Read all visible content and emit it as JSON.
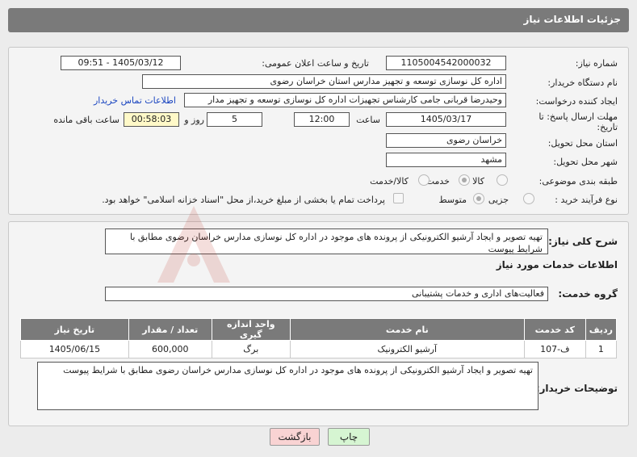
{
  "header": {
    "title": "جزئیات اطلاعات نیاز"
  },
  "form": {
    "need_number_label": "شماره نیاز:",
    "need_number": "1105004542000032",
    "announce_label": "تاریخ و ساعت اعلان عمومی:",
    "announce_value": "1405/03/12 - 09:51",
    "buyer_org_label": "نام دستگاه خریدار:",
    "buyer_org": "اداره کل نوسازی  توسعه و تجهیز مدارس استان خراسان رضوی",
    "creator_label": "ایجاد کننده درخواست:",
    "creator": "وحیدرضا قربانی جامی کارشناس تجهیزات اداره کل نوسازی  توسعه و تجهیز مدار",
    "contact_link": "اطلاعات تماس خریدار",
    "deadline_label_1": "مهلت ارسال پاسخ: تا",
    "deadline_label_2": "تاریخ:",
    "deadline_date": "1405/03/17",
    "time_label": "ساعت",
    "deadline_time": "12:00",
    "days_value": "5",
    "days_label": "روز و",
    "remaining_time": "00:58:03",
    "remaining_label": "ساعت باقی مانده",
    "province_label": "استان محل تحویل:",
    "province": "خراسان رضوی",
    "city_label": "شهر محل تحویل:",
    "city": "مشهد",
    "category_label": "طبقه بندی موضوعی:",
    "category_options": [
      "کالا",
      "خدمت",
      "کالا/خدمت"
    ],
    "category_selected": "خدمت",
    "process_label": "نوع فرآیند خرید :",
    "process_options": [
      "جزیی",
      "متوسط"
    ],
    "process_selected": "متوسط",
    "payment_note": "پرداخت تمام یا بخشی از مبلغ خرید،از محل \"اسناد خزانه اسلامی\" خواهد بود."
  },
  "description": {
    "label": "شرح کلی نیاز:",
    "text": "تهیه تصویر و ایجاد آرشیو الکترونیکی از پرونده های موجود در اداره کل نوسازی مدارس خراسان رضوی مطابق با شرایط پیوست"
  },
  "services": {
    "title": "اطلاعات خدمات مورد نیاز",
    "group_label": "گروه خدمت:",
    "group_value": "فعالیت‌های اداری و خدمات پشتیبانی",
    "columns": [
      "ردیف",
      "کد خدمت",
      "نام خدمت",
      "واحد اندازه گیری",
      "تعداد / مقدار",
      "تاریخ نیاز"
    ],
    "rows": [
      [
        "1",
        "ف-107",
        "آرشیو الکترونیک",
        "برگ",
        "600,000",
        "1405/06/15"
      ]
    ]
  },
  "buyer_notes": {
    "label": "توضیحات خریدار:",
    "text": "تهیه تصویر و ایجاد آرشیو الکترونیکی از پرونده های موجود در اداره کل نوسازی مدارس خراسان رضوی مطابق با شرایط پیوست"
  },
  "buttons": {
    "print": "چاپ",
    "back": "بازگشت"
  },
  "colors": {
    "header_bg": "#7a7a7a",
    "link": "#1a45c0",
    "time_box": "#fff9c8",
    "print_btn": "#d6f5d2",
    "back_btn": "#f9d3d3"
  }
}
